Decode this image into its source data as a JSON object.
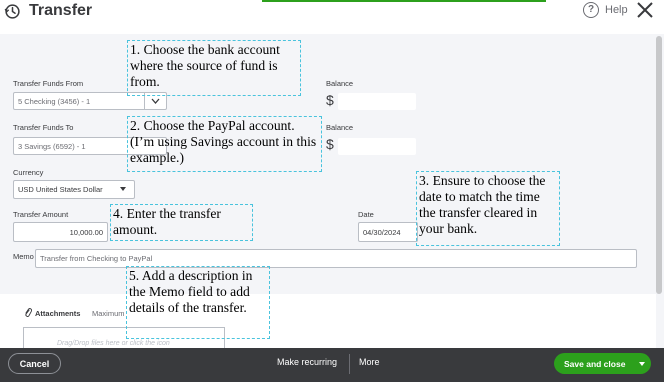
{
  "header": {
    "title": "Transfer",
    "help_label": "Help"
  },
  "form": {
    "from": {
      "label": "Transfer Funds From",
      "value": "5 Checking (3456) - 1",
      "balance_label": "Balance",
      "currency_symbol": "$"
    },
    "to": {
      "label": "Transfer Funds To",
      "value": "3 Savings (6592) - 1",
      "balance_label": "Balance",
      "currency_symbol": "$"
    },
    "currency": {
      "label": "Currency",
      "value": "USD United States Dollar"
    },
    "amount": {
      "label": "Transfer Amount",
      "value": "10,000.00"
    },
    "date": {
      "label": "Date",
      "value": "04/30/2024"
    },
    "memo": {
      "label": "Memo",
      "value": "Transfer from Checking to PayPal"
    }
  },
  "callouts": {
    "step1": "1. Choose the bank account where the source of fund is from.",
    "step2": "2. Choose the PayPal account. (I’m using Savings account in this example.)",
    "step3": "3. Ensure to choose the date to match the time the transfer cleared in your bank.",
    "step4": "4. Enter the transfer amount.",
    "step5": "5. Add a description in the Memo field to add details of the transfer."
  },
  "attachments": {
    "label": "Attachments",
    "max_text": "Maximum",
    "drop_text": "Drag/Drop files here or click the icon"
  },
  "footer": {
    "cancel": "Cancel",
    "make_recurring": "Make recurring",
    "more": "More",
    "save_close": "Save and close"
  },
  "colors": {
    "accent": "#2ca01c",
    "footer_bg": "#393a3d",
    "callout_border": "#49c3dd"
  }
}
